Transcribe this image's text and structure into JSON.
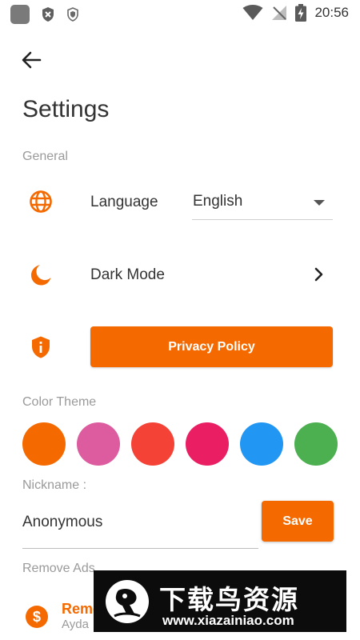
{
  "status_bar": {
    "time": "20:56",
    "left_icons": [
      "app-icon",
      "shield-x-icon",
      "shield-small-icon"
    ],
    "right_icons": [
      "wifi-icon",
      "no-signal-icon",
      "battery-charging-icon"
    ]
  },
  "header": {
    "title": "Settings"
  },
  "general": {
    "section_label": "General",
    "language": {
      "label": "Language",
      "value": "English",
      "icon": "globe-icon"
    },
    "dark_mode": {
      "label": "Dark Mode",
      "icon": "moon-icon"
    },
    "privacy": {
      "label": "Privacy Policy",
      "icon": "shield-info-icon"
    }
  },
  "color_theme": {
    "section_label": "Color Theme",
    "swatches": [
      "#f56a00",
      "#dc5c9f",
      "#f44336",
      "#e91e63",
      "#2196f3",
      "#4caf50"
    ]
  },
  "nickname": {
    "label": "Nickname :",
    "value": "Anonymous",
    "save_label": "Save"
  },
  "remove_ads": {
    "section_label": "Remove Ads",
    "item_title": "Remo",
    "item_subtitle": "Ayda"
  },
  "watermark": {
    "text_cn": "下载鸟资源",
    "url": "www.xiazainiao.com"
  },
  "colors": {
    "accent": "#f56a00",
    "section_text": "#9a9a9a",
    "primary_text": "#333333"
  }
}
